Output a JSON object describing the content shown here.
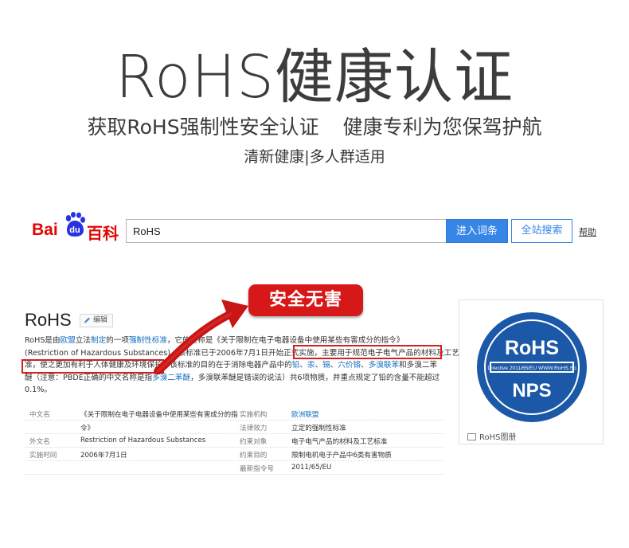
{
  "hero": {
    "title": "RoHS健康认证",
    "subtitle_left": "获取RoHS强制性安全认证",
    "subtitle_right": "健康专利为您保驾护航",
    "tagline": "清新健康|多人群适用"
  },
  "baike_logo": {
    "bai": "Bai",
    "du": "du",
    "baike": "百科"
  },
  "search": {
    "query": "RoHS",
    "enter_label": "进入词条",
    "site_label": "全站搜索",
    "help_label": "帮助"
  },
  "badge": {
    "label": "安全无害"
  },
  "colors": {
    "accent_red": "#d71818",
    "baidu_blue": "#3885e8",
    "link_blue": "#136ec2",
    "rohs_blue": "#1b58a8"
  },
  "article": {
    "title": "RoHS",
    "edit_label": "编辑",
    "lines": [
      {
        "parts": [
          {
            "t": "RoHS是由",
            "link": false
          },
          {
            "t": "欧盟",
            "link": true
          },
          {
            "t": "立法",
            "link": false
          },
          {
            "t": "制定",
            "link": true
          },
          {
            "t": "的一项",
            "link": false
          },
          {
            "t": "强制性标准",
            "link": true
          },
          {
            "t": "，它的全称是《关于限制在电子电器设备中使用某些有害成分的指令》",
            "link": false
          }
        ]
      },
      {
        "parts": [
          {
            "t": "(Restriction of Hazardous Substances)。该标准已于2006年7月1日开始正式实施，",
            "link": false
          },
          {
            "t": "主要用于规范电子电气产品的材料及工艺标",
            "link": false
          }
        ]
      },
      {
        "parts": [
          {
            "t": "准，使之更加有利于人体健康及环境保护。",
            "link": false
          },
          {
            "t": "该标准的目的在于消除电器产品中的",
            "link": false
          },
          {
            "t": "铅",
            "link": true
          },
          {
            "t": "、",
            "link": false
          },
          {
            "t": "汞",
            "link": true
          },
          {
            "t": "、",
            "link": false
          },
          {
            "t": "镉",
            "link": true
          },
          {
            "t": "、",
            "link": false
          },
          {
            "t": "六价铬",
            "link": true
          },
          {
            "t": "、",
            "link": false
          },
          {
            "t": "多溴联苯",
            "link": true
          },
          {
            "t": "和多溴二苯",
            "link": false
          }
        ]
      },
      {
        "parts": [
          {
            "t": "醚（注意：PBDE正确的中文名称是指",
            "link": false
          },
          {
            "t": "多溴二苯醚",
            "link": true
          },
          {
            "t": "，多溴联苯醚是错误的说法）共6项物质，并重点规定了铅的含量不能超过",
            "link": false
          }
        ]
      },
      {
        "parts": [
          {
            "t": "0.1%。",
            "link": false
          }
        ]
      }
    ],
    "info_rows": [
      {
        "k1": "中文名",
        "v1": "《关于限制在电子电器设备中使用某些有害成分的指",
        "k2": "实施机构",
        "v2": "欧洲联盟",
        "v2_link": true
      },
      {
        "k1": "",
        "v1": "令》",
        "k2": "法律效力",
        "v2": "立定的强制性标准",
        "v2_link": false
      },
      {
        "k1": "外文名",
        "v1": "Restriction of Hazardous Substances",
        "k2": "约束对象",
        "v2": "电子电气产品的材料及工艺标准",
        "v2_link": false
      },
      {
        "k1": "实施时间",
        "v1": "2006年7月1日",
        "k2": "约束目的",
        "v2": "限制电机电子产品中6类有害物质",
        "v2_link": false
      },
      {
        "k1": "",
        "v1": "",
        "k2": "最新指令号",
        "v2": "2011/65/EU",
        "v2_link": false
      }
    ]
  },
  "album": {
    "logo_top": "RoHS",
    "logo_directive": "Directive 2011/65/EU WWW.RoHS.So",
    "logo_bottom": "NPS",
    "caption": "RoHS图册"
  }
}
